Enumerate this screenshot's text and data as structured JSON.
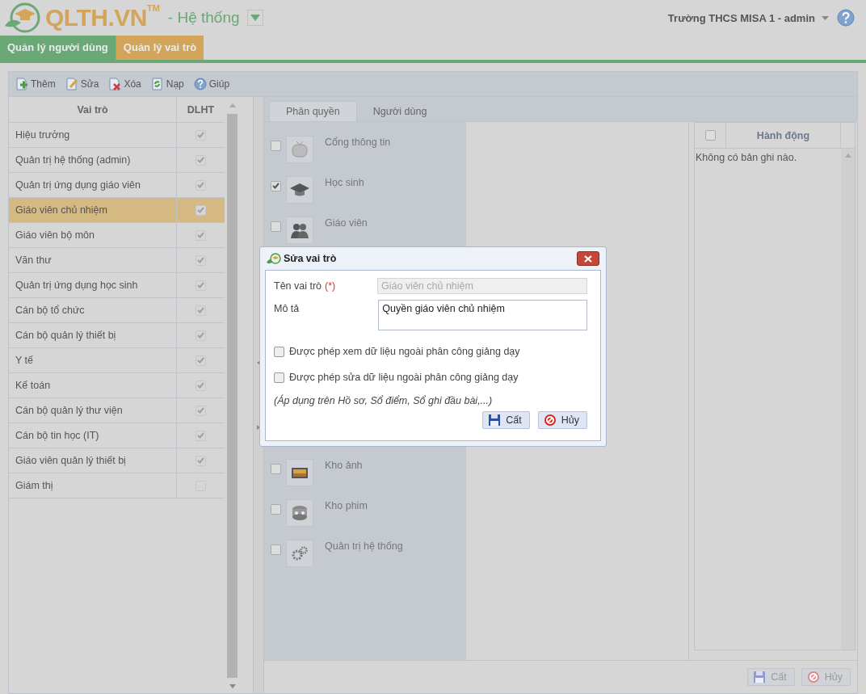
{
  "header": {
    "logo": "QLTH.VN",
    "trademark": "TM",
    "module": "- Hệ thống",
    "user": "Trường THCS MISA 1 - admin"
  },
  "tabs": [
    {
      "label": "Quản lý người dùng",
      "selected": false
    },
    {
      "label": "Quản lý vai trò",
      "selected": true
    }
  ],
  "toolbar": [
    {
      "label": "Thêm",
      "kind": "add"
    },
    {
      "label": "Sửa",
      "kind": "edit"
    },
    {
      "label": "Xóa",
      "kind": "delete"
    },
    {
      "label": "Nạp",
      "kind": "reload"
    },
    {
      "label": "Giúp",
      "kind": "help"
    }
  ],
  "roles_table": {
    "columns": [
      "Vai trò",
      "DLHT"
    ],
    "rows": [
      {
        "name": "Hiệu trưởng",
        "dlht": true,
        "selected": false
      },
      {
        "name": "Quản trị hệ thống (admin)",
        "dlht": true,
        "selected": false
      },
      {
        "name": "Quản trị ứng dụng giáo viên",
        "dlht": true,
        "selected": false
      },
      {
        "name": "Giáo viên chủ nhiệm",
        "dlht": true,
        "selected": true
      },
      {
        "name": "Giáo viên bộ môn",
        "dlht": true,
        "selected": false
      },
      {
        "name": "Văn thư",
        "dlht": true,
        "selected": false
      },
      {
        "name": "Quản trị ứng dụng học sinh",
        "dlht": true,
        "selected": false
      },
      {
        "name": "Cán bộ tổ chức",
        "dlht": true,
        "selected": false
      },
      {
        "name": "Cán bộ quản lý thiết bị",
        "dlht": true,
        "selected": false
      },
      {
        "name": "Y tế",
        "dlht": true,
        "selected": false
      },
      {
        "name": "Kế toán",
        "dlht": true,
        "selected": false
      },
      {
        "name": "Cán bộ quản lý thư viện",
        "dlht": true,
        "selected": false
      },
      {
        "name": "Cán bộ tin học (IT)",
        "dlht": true,
        "selected": false
      },
      {
        "name": "Giáo viên quản lý thiết bị",
        "dlht": true,
        "selected": false
      },
      {
        "name": "Giám thị",
        "dlht": false,
        "selected": false
      }
    ]
  },
  "detail_tabs": [
    {
      "label": "Phân quyền",
      "selected": true
    },
    {
      "label": "Người dùng",
      "selected": false
    }
  ],
  "modules": [
    {
      "label": "Cổng thông tin",
      "checked": false,
      "kind": "tv"
    },
    {
      "label": "Học sinh",
      "checked": true,
      "kind": "cap"
    },
    {
      "label": "Giáo viên",
      "checked": false,
      "kind": "people"
    },
    {
      "label": "Kho ảnh",
      "checked": false,
      "kind": "photo"
    },
    {
      "label": "Kho phim",
      "checked": false,
      "kind": "film"
    },
    {
      "label": "Quản trị hệ thống",
      "checked": false,
      "kind": "gears"
    }
  ],
  "actions_table": {
    "columns": [
      "Hành động"
    ],
    "select_all": false,
    "empty_text": "Không có bản ghi nào."
  },
  "footer_buttons": [
    {
      "label": "Cất",
      "kind": "save",
      "disabled": true
    },
    {
      "label": "Hủy",
      "kind": "cancel",
      "disabled": true
    }
  ],
  "dialog": {
    "title": "Sửa vai trò",
    "name_label": "Tên vai trò",
    "required_mark": "(*)",
    "name_value": "Giáo viên chủ nhiệm",
    "name_disabled": true,
    "desc_label": "Mô tả",
    "desc_value": "Quyền giáo viên chủ nhiệm",
    "options": [
      {
        "label": "Được phép xem dữ liệu ngoài phân công giảng dạy",
        "checked": false
      },
      {
        "label": "Được phép sửa dữ liệu ngoài phân công giảng dạy",
        "checked": false
      }
    ],
    "note": "(Áp dụng trên Hồ sơ, Sổ điểm, Sổ ghi đầu bài,...)",
    "buttons": [
      {
        "label": "Cất",
        "kind": "save",
        "disabled": false
      },
      {
        "label": "Hủy",
        "kind": "cancel",
        "disabled": false
      }
    ]
  }
}
